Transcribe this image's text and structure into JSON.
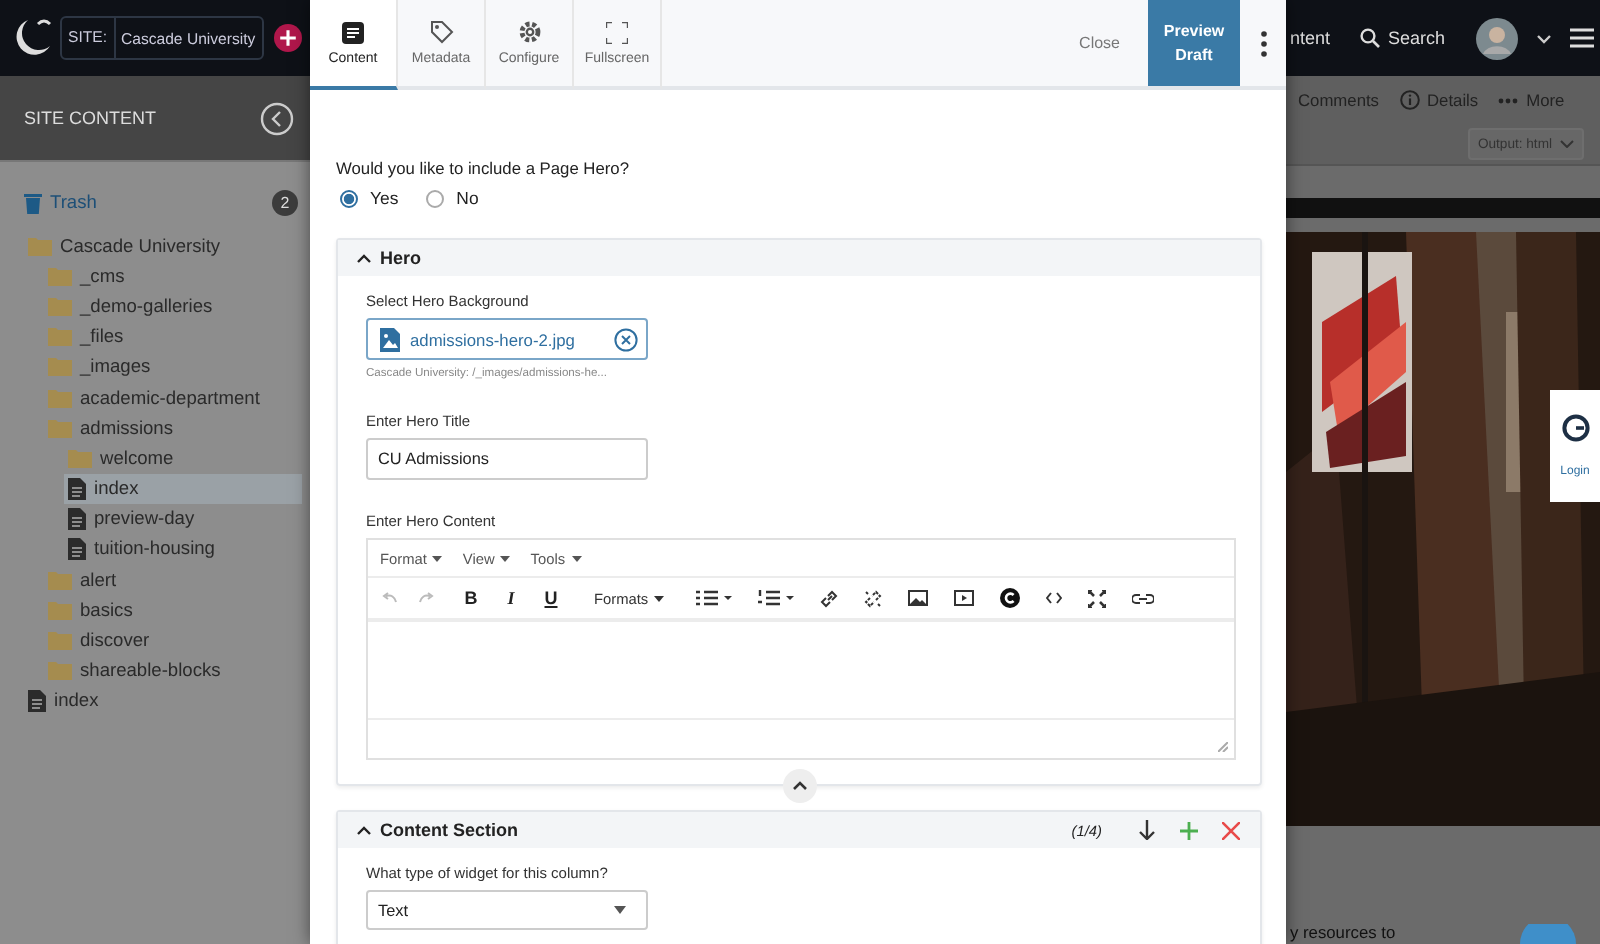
{
  "app_bar": {
    "site_label": "SITE:",
    "site_name": "Cascade University",
    "partial_nav": "ntent",
    "search": "Search"
  },
  "sidebar": {
    "title": "SITE CONTENT",
    "trash": {
      "label": "Trash",
      "count": "2"
    },
    "tree": [
      {
        "label": "Cascade University",
        "kind": "folder",
        "selected": false,
        "children": [
          {
            "label": "_cms",
            "kind": "folder",
            "selected": false
          },
          {
            "label": "_demo-galleries",
            "kind": "folder",
            "selected": false
          },
          {
            "label": "_files",
            "kind": "folder",
            "selected": false
          },
          {
            "label": "_images",
            "kind": "folder",
            "selected": false
          },
          {
            "label": "academic-department",
            "kind": "folder",
            "selected": false
          },
          {
            "label": "admissions",
            "kind": "folder",
            "selected": false,
            "children": [
              {
                "label": "welcome",
                "kind": "folder",
                "selected": false
              },
              {
                "label": "index",
                "kind": "page",
                "selected": true
              },
              {
                "label": "preview-day",
                "kind": "page",
                "selected": false
              },
              {
                "label": "tuition-housing",
                "kind": "page",
                "selected": false
              }
            ]
          },
          {
            "label": "alert",
            "kind": "folder",
            "selected": false
          },
          {
            "label": "basics",
            "kind": "folder",
            "selected": false
          },
          {
            "label": "discover",
            "kind": "folder",
            "selected": false
          },
          {
            "label": "shareable-blocks",
            "kind": "folder",
            "selected": false
          }
        ]
      },
      {
        "label": "index",
        "kind": "page",
        "selected": false
      }
    ]
  },
  "editor": {
    "tabs": [
      {
        "label": "Content",
        "kind": "content",
        "selected": true
      },
      {
        "label": "Metadata",
        "kind": "tag",
        "selected": false
      },
      {
        "label": "Configure",
        "kind": "gear",
        "selected": false
      },
      {
        "label": "Fullscreen",
        "kind": "expand",
        "selected": false
      }
    ],
    "close": "Close",
    "preview": "Preview Draft",
    "hero_question": "Would you like to include a Page Hero?",
    "hero_options": [
      {
        "label": "Yes",
        "selected": true
      },
      {
        "label": "No",
        "selected": false
      }
    ],
    "hero": {
      "title": "Hero",
      "expanded": true,
      "background_label": "Select Hero Background",
      "file_name": "admissions-hero-2.jpg",
      "file_path": "Cascade University: /_images/admissions-he...",
      "title_label": "Enter Hero Title",
      "title_value": "CU Admissions",
      "content_label": "Enter Hero Content",
      "menus": [
        "Format",
        "View",
        "Tools"
      ],
      "text_buttons": [
        "B",
        "I",
        "U"
      ],
      "formats": "Formats"
    },
    "content_section": {
      "title": "Content Section",
      "expanded": true,
      "count": "(1/4)",
      "question": "What type of widget for this column?",
      "widget": "Text"
    }
  },
  "preview_page": {
    "actions": [
      "Comments",
      "Details",
      "More"
    ],
    "output": "Output: html",
    "login": "Login",
    "body_text": "y resources to"
  }
}
